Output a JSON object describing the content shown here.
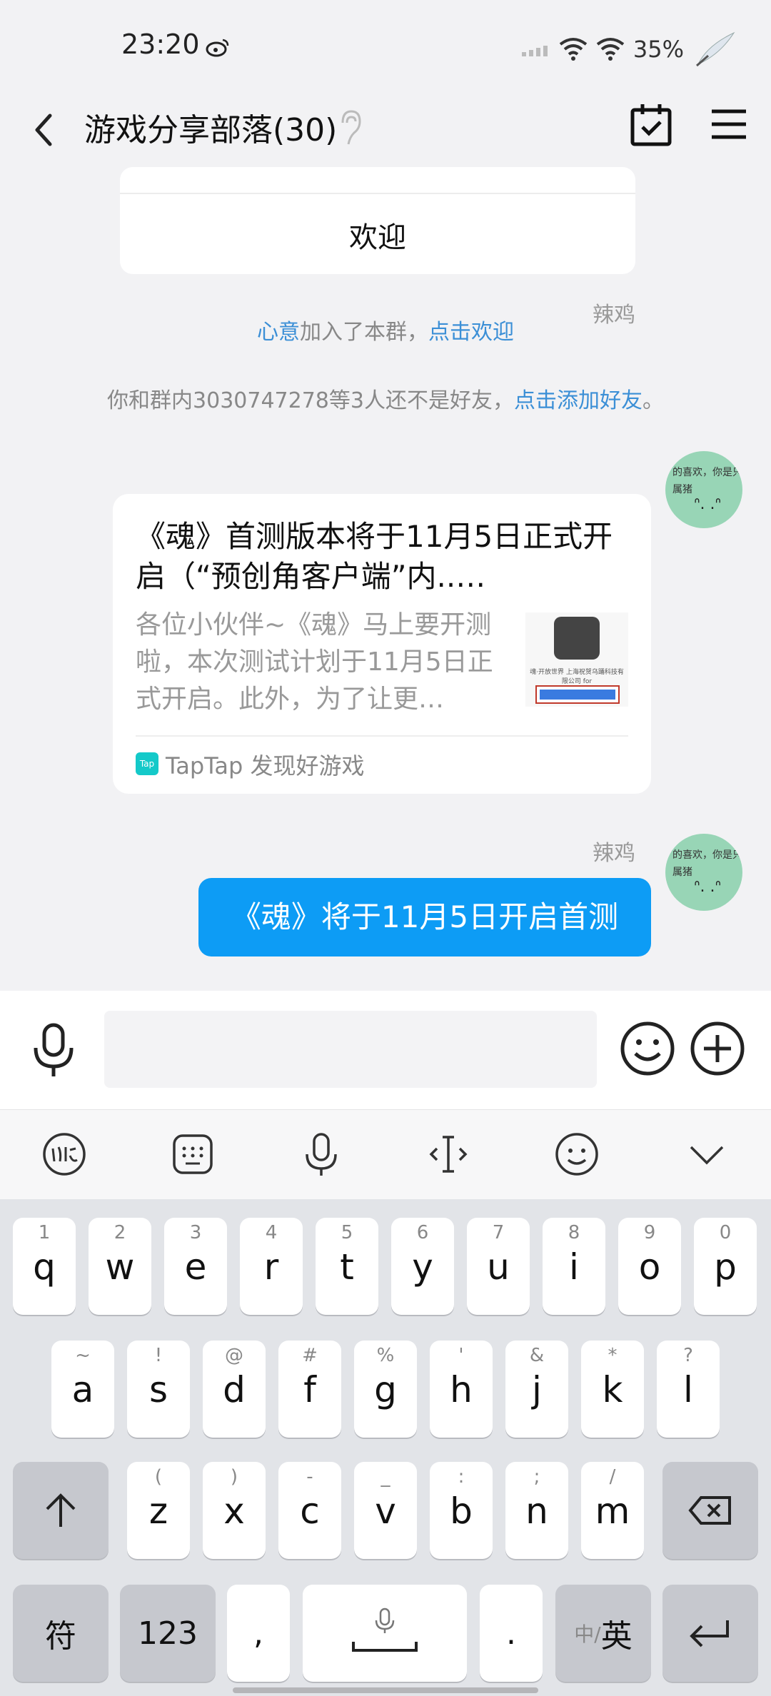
{
  "status_bar": {
    "time": "23:20",
    "battery": "35%"
  },
  "header": {
    "title": "游戏分享部落(30)"
  },
  "chat": {
    "welcome_button": "欢迎",
    "system_join": {
      "name": "心意",
      "text": "加入了本群，",
      "link": "点击欢迎"
    },
    "system_friends": {
      "text": "你和群内3030747278等3人还不是好友，",
      "link": "点击添加好友",
      "suffix": "。"
    },
    "messages": [
      {
        "sender": "辣鸡",
        "type": "share-card",
        "title": "《魂》首测版本将于11月5日正式开启（“预创角客户端”内..…",
        "description": "各位小伙伴~《魂》马上要开测啦，本次测试计划于11月5日正式开启。此外，为了让更…",
        "thumbnail_text": "魂·开放世界 上海祝贺乌踊科技有限公司 for",
        "source_icon": "Tap",
        "source": "TapTap 发现好游戏"
      },
      {
        "sender": "辣鸡",
        "type": "text",
        "text": "《魂》将于11月5日开启首测"
      }
    ],
    "avatar_text": "的喜欢，你是只属猪",
    "avatar_face": "ᐢ. .ᐢ"
  },
  "input": {
    "placeholder": ""
  },
  "keyboard": {
    "row1": [
      {
        "hint": "1",
        "key": "q"
      },
      {
        "hint": "2",
        "key": "w"
      },
      {
        "hint": "3",
        "key": "e"
      },
      {
        "hint": "4",
        "key": "r"
      },
      {
        "hint": "5",
        "key": "t"
      },
      {
        "hint": "6",
        "key": "y"
      },
      {
        "hint": "7",
        "key": "u"
      },
      {
        "hint": "8",
        "key": "i"
      },
      {
        "hint": "9",
        "key": "o"
      },
      {
        "hint": "0",
        "key": "p"
      }
    ],
    "row2": [
      {
        "hint": "~",
        "key": "a"
      },
      {
        "hint": "!",
        "key": "s"
      },
      {
        "hint": "@",
        "key": "d"
      },
      {
        "hint": "#",
        "key": "f"
      },
      {
        "hint": "%",
        "key": "g"
      },
      {
        "hint": "'",
        "key": "h"
      },
      {
        "hint": "&",
        "key": "j"
      },
      {
        "hint": "*",
        "key": "k"
      },
      {
        "hint": "?",
        "key": "l"
      }
    ],
    "row3": [
      {
        "hint": "(",
        "key": "z"
      },
      {
        "hint": ")",
        "key": "x"
      },
      {
        "hint": "-",
        "key": "c"
      },
      {
        "hint": "_",
        "key": "v"
      },
      {
        "hint": ":",
        "key": "b"
      },
      {
        "hint": ";",
        "key": "n"
      },
      {
        "hint": "/",
        "key": "m"
      }
    ],
    "symbols_key": "符",
    "numbers_key": "123",
    "comma_key": ",",
    "period_key": ".",
    "lang_key_small": "中/",
    "lang_key": "英"
  }
}
